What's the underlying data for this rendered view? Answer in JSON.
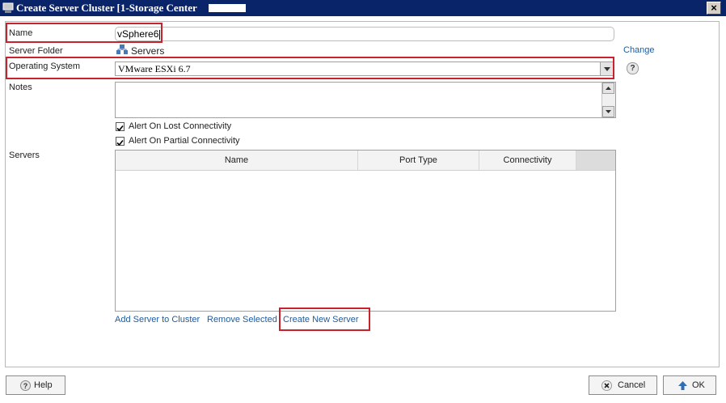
{
  "window": {
    "title": "Create Server Cluster [1-Storage Center",
    "close_label": "×"
  },
  "form": {
    "name_label": "Name",
    "name_value": "vSphere6",
    "folder_label": "Server Folder",
    "folder_value": "Servers",
    "change_label": "Change",
    "os_label": "Operating System",
    "os_value": "VMware ESXi 6.7",
    "help_label": "?",
    "notes_label": "Notes",
    "alert_lost_label": "Alert On Lost Connectivity",
    "alert_lost_checked": true,
    "alert_partial_label": "Alert On Partial Connectivity",
    "alert_partial_checked": true,
    "servers_label": "Servers"
  },
  "servers_table": {
    "columns": [
      "Name",
      "Port Type",
      "Connectivity"
    ],
    "rows": []
  },
  "actions": {
    "add_server": "Add Server to Cluster",
    "remove_selected": "Remove Selected",
    "create_new_server": "Create New Server"
  },
  "footer": {
    "help_label": "Help",
    "cancel_label": "Cancel",
    "ok_label": "OK"
  },
  "icons": [
    "app-icon",
    "server-folder-icon",
    "dropdown-arrow-icon",
    "scroll-up-icon",
    "scroll-down-icon",
    "checkmark-icon",
    "help-icon",
    "cancel-x-icon",
    "ok-arrow-icon"
  ],
  "colors": {
    "title_bar": "#0a246a",
    "link": "#1e5b9c",
    "highlight_box": "#c8232c"
  }
}
